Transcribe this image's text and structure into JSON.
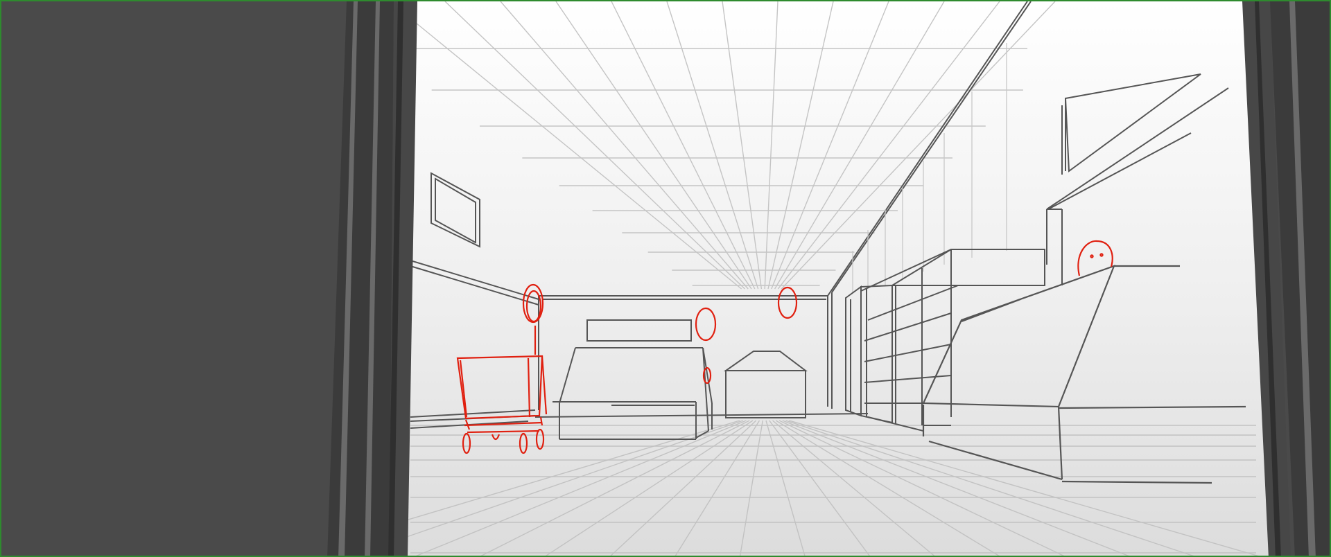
{
  "scene": {
    "kind": "storyboard-sketch",
    "subject": "",
    "colors": {
      "outer_panel": "#4a4a4a",
      "door_frame": "#3b3b3b",
      "door_frame_highlight": "#6a6a6a",
      "paper": "#f2f2f2",
      "guide_line": "#bdbdbd",
      "sketch_line": "#555555",
      "figure_line": "#e02010",
      "border": "#2e8b2e"
    },
    "figure_icons": [
      "person-near-entrance-icon",
      "person-behind-display-icon",
      "person-in-aisle-icon",
      "person-behind-counter-icon",
      "shopping-cart-icon"
    ]
  }
}
